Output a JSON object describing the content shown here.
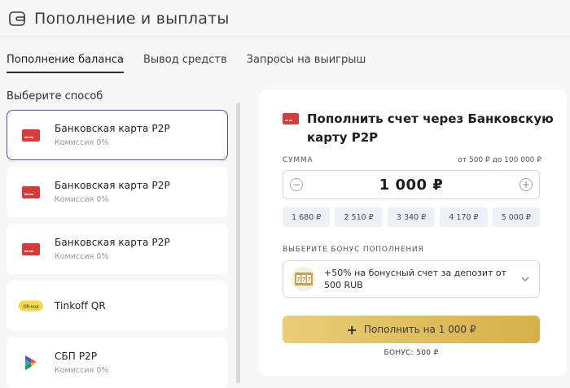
{
  "header": {
    "title": "Пополнение и выплаты"
  },
  "tabs": [
    {
      "label": "Пополнение баланса",
      "active": true
    },
    {
      "label": "Вывод средств",
      "active": false
    },
    {
      "label": "Запросы на выигрыш",
      "active": false
    }
  ],
  "methods_label": "Выберите способ",
  "methods": [
    {
      "name": "Банковская карта P2P",
      "fee": "Комиссия 0%",
      "icon": "bank-card-icon",
      "active": true
    },
    {
      "name": "Банковская карта P2P",
      "fee": "Комиссия 0%",
      "icon": "bank-card-icon",
      "active": false
    },
    {
      "name": "Банковская карта P2P",
      "fee": "Комиссия 0%",
      "icon": "bank-card-icon",
      "active": false
    },
    {
      "name": "Tinkoff QR",
      "fee": "",
      "icon": "qr-code-icon",
      "badge": "QR-код",
      "active": false
    },
    {
      "name": "СБП P2P",
      "fee": "Комиссия 0%",
      "icon": "sbp-icon",
      "active": false
    }
  ],
  "panel": {
    "title": "Пополнить счет через Банковскую карту P2P",
    "sum_label": "СУММА",
    "sum_range": "от 500 ₽ до 100 000 ₽",
    "amount": "1 000 ₽",
    "presets": [
      "1 680 ₽",
      "2 510 ₽",
      "3 340 ₽",
      "4 170 ₽",
      "5 000 ₽"
    ],
    "bonus_label": "ВЫБЕРИТЕ БОНУС ПОПОЛНЕНИЯ",
    "bonus_option": "+50% на бонусный счет за депозит от 500 RUB",
    "cta_label": "Пополнить на 1 000 ₽",
    "bonus_note": "БОНУС: 500 ₽"
  },
  "colors": {
    "accent_border": "#3a57a8",
    "card_red": "#d83a3a",
    "cta_gold": "#e2c062",
    "preset_bg": "#edf1f7"
  }
}
